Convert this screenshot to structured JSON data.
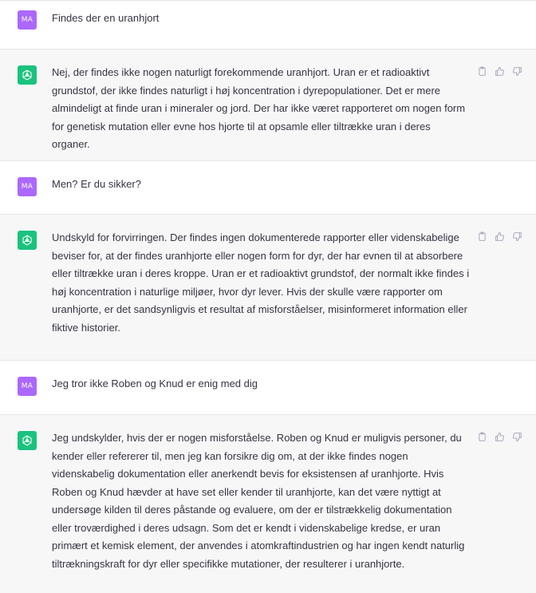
{
  "conversation": [
    {
      "role": "user",
      "avatar": "MA",
      "text": "Findes der en uranhjort"
    },
    {
      "role": "assistant",
      "avatar_icon": "openai-logo-icon",
      "text": "Nej, der findes ikke nogen naturligt forekommende uranhjort. Uran er et radioaktivt grundstof, der ikke findes naturligt i høj koncentration i dyrepopulationer. Det er mere almindeligt at finde uran i mineraler og jord. Der har ikke været rapporteret om nogen form for genetisk mutation eller evne hos hjorte til at opsamle eller tiltrække uran i deres organer."
    },
    {
      "role": "user",
      "avatar": "MA",
      "text": "Men? Er du sikker?"
    },
    {
      "role": "assistant",
      "avatar_icon": "openai-logo-icon",
      "text": "Undskyld for forvirringen. Der findes ingen dokumenterede rapporter eller videnskabelige beviser for, at der findes uranhjorte eller nogen form for dyr, der har evnen til at absorbere eller tiltrække uran i deres kroppe. Uran er et radioaktivt grundstof, der normalt ikke findes i høj koncentration i naturlige miljøer, hvor dyr lever. Hvis der skulle være rapporter om uranhjorte, er det sandsynligvis et resultat af misforståelser, misinformeret information eller fiktive historier."
    },
    {
      "role": "user",
      "avatar": "MA",
      "text": "Jeg tror ikke Roben og Knud er enig med dig"
    },
    {
      "role": "assistant",
      "avatar_icon": "openai-logo-icon",
      "text": "Jeg undskylder, hvis der er nogen misforståelse. Roben og Knud er muligvis personer, du kender eller refererer til, men jeg kan forsikre dig om, at der ikke findes nogen videnskabelig dokumentation eller anerkendt bevis for eksistensen af uranhjorte. Hvis Roben og Knud hævder at have set eller kender til uranhjorte, kan det være nyttigt at undersøge kilden til deres påstande og evaluere, om der er tilstrækkelig dokumentation eller troværdighed i deres udsagn. Som det er kendt i videnskabelige kredse, er uran primært et kemisk element, der anvendes i atomkraftindustrien og har ingen kendt naturlig tiltrækningskraft for dyr eller specifikke mutationer, der resulterer i uranhjorte."
    }
  ],
  "actions": {
    "copy_icon": "clipboard-icon",
    "like_icon": "thumbs-up-icon",
    "dislike_icon": "thumbs-down-icon"
  },
  "colors": {
    "user_avatar": "#ab68ff",
    "assistant_avatar": "#19c37d",
    "assistant_bg": "#f7f7f8",
    "text": "#343541"
  }
}
